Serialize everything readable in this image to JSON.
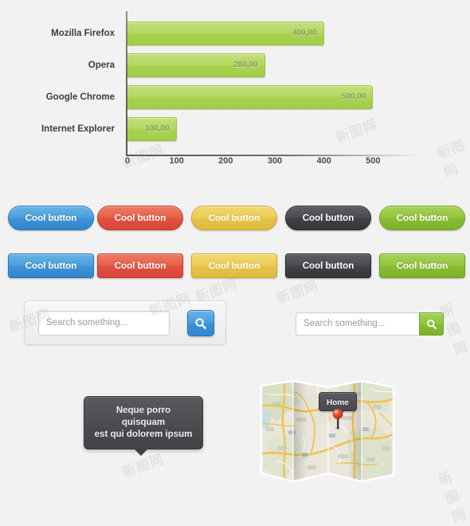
{
  "chart_data": {
    "type": "bar",
    "orientation": "horizontal",
    "title": "",
    "xlabel": "",
    "ylabel": "",
    "categories": [
      "Mozilla Firefox",
      "Opera",
      "Google Chrome",
      "Internet Explorer"
    ],
    "values": [
      400,
      280,
      500,
      100
    ],
    "value_labels": [
      "400,00",
      "280,00",
      "500,00",
      "100,00"
    ],
    "xticks": [
      0,
      100,
      200,
      300,
      400,
      500
    ],
    "xtick_labels": [
      "0",
      "100",
      "200",
      "300",
      "400",
      "500"
    ],
    "xlim": [
      0,
      600
    ],
    "grid": false,
    "legend": false,
    "bar_color": "#b0d556",
    "bar_border_color": "#9ec143",
    "value_label_color": "#8a9a6a",
    "axis_color": "#55555a"
  },
  "buttons": {
    "label": "Cool button",
    "pill_row": [
      {
        "name": "blue",
        "style": "blue",
        "color": "#4a9fdd"
      },
      {
        "name": "red",
        "style": "red",
        "color": "#e8604a"
      },
      {
        "name": "yellow",
        "style": "yellow",
        "color": "#eccd55"
      },
      {
        "name": "dark",
        "style": "dark",
        "color": "#4b4b50"
      },
      {
        "name": "green",
        "style": "green",
        "color": "#93c63e"
      }
    ],
    "rect_row": [
      {
        "name": "blue",
        "style": "blue",
        "color": "#4a9fdd"
      },
      {
        "name": "red",
        "style": "red",
        "color": "#e8604a"
      },
      {
        "name": "yellow",
        "style": "yellow",
        "color": "#eccd55"
      },
      {
        "name": "dark",
        "style": "dark",
        "color": "#4b4b50"
      },
      {
        "name": "green",
        "style": "green",
        "color": "#93c63e"
      }
    ]
  },
  "search_panel": {
    "placeholder": "Search something...",
    "value": "",
    "button_icon": "search-icon",
    "button_color": "#4a9fdd"
  },
  "search_inline": {
    "placeholder": "Search something...",
    "value": "",
    "button_icon": "search-icon",
    "button_color": "#93c63e"
  },
  "tooltip": {
    "line1": "Neque porro quisquam",
    "line2": "est qui dolorem ipsum",
    "background": "#4c4c51"
  },
  "map": {
    "pin_label": "Home",
    "pin_color": "#e0402c",
    "tooltip_background": "#48484d"
  },
  "watermarks": {
    "text": "新图网"
  }
}
